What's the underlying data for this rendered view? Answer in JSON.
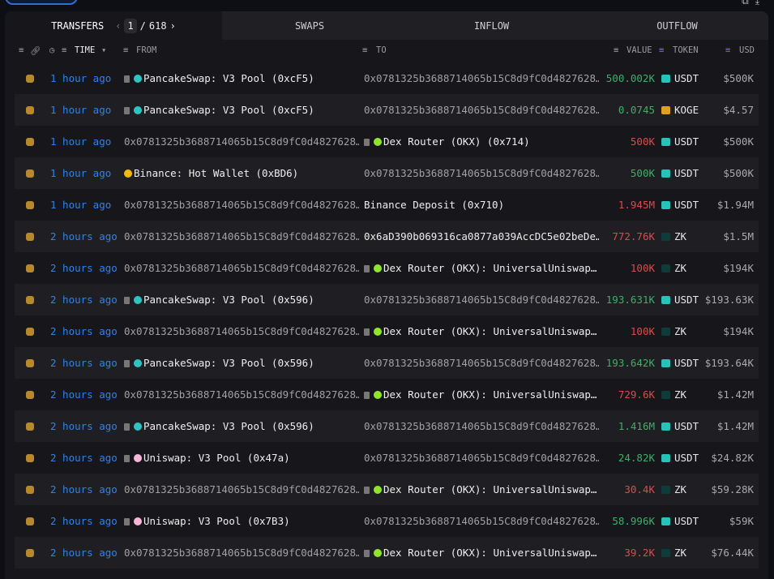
{
  "tabs": {
    "transfers": "TRANSFERS",
    "swaps": "SWAPS",
    "inflow": "INFLOW",
    "outflow": "OUTFLOW"
  },
  "pager": {
    "current": "1",
    "separator": "/",
    "total": "618",
    "prev": "‹",
    "next": "›"
  },
  "columns": {
    "time": "TIME",
    "from": "FROM",
    "to": "TO",
    "value": "VALUE",
    "token": "TOKEN",
    "usd": "USD"
  },
  "colors": {
    "positive": "#3fae6a",
    "negative": "#d94c4c",
    "link": "#2f82e6"
  },
  "rows": [
    {
      "time": "1 hour ago",
      "from": "PancakeSwap: V3 Pool (0xcF5)",
      "from_icon": "pancake",
      "to": "0x0781325b3688714065b15C8d9fC0d4827628…",
      "to_icon": "",
      "value": "500.002K",
      "dir": "pos",
      "token": "USDT",
      "usd": "$500K"
    },
    {
      "time": "1 hour ago",
      "from": "PancakeSwap: V3 Pool (0xcF5)",
      "from_icon": "pancake",
      "to": "0x0781325b3688714065b15C8d9fC0d4827628…",
      "to_icon": "",
      "value": "0.0745",
      "dir": "pos",
      "token": "KOGE",
      "usd": "$4.57"
    },
    {
      "time": "1 hour ago",
      "from": "0x0781325b3688714065b15C8d9fC0d4827628…",
      "from_icon": "",
      "to": "Dex Router (OKX) (0x714)",
      "to_icon": "okx",
      "value": "500K",
      "dir": "neg",
      "token": "USDT",
      "usd": "$500K"
    },
    {
      "time": "1 hour ago",
      "from": "Binance: Hot Wallet (0xBD6)",
      "from_icon": "binance",
      "to": "0x0781325b3688714065b15C8d9fC0d4827628…",
      "to_icon": "",
      "value": "500K",
      "dir": "pos",
      "token": "USDT",
      "usd": "$500K"
    },
    {
      "time": "1 hour ago",
      "from": "0x0781325b3688714065b15C8d9fC0d4827628…",
      "from_icon": "",
      "to": "Binance Deposit (0x710)",
      "to_icon": "none-ent",
      "value": "1.945M",
      "dir": "neg",
      "token": "USDT",
      "usd": "$1.94M"
    },
    {
      "time": "2 hours ago",
      "from": "0x0781325b3688714065b15C8d9fC0d4827628…",
      "from_icon": "",
      "to": "0x6aD390b069316ca0877a039AccDC5e02beDe…",
      "to_icon": "none-ent",
      "value": "772.76K",
      "dir": "neg",
      "token": "ZK",
      "usd": "$1.5M"
    },
    {
      "time": "2 hours ago",
      "from": "0x0781325b3688714065b15C8d9fC0d4827628…",
      "from_icon": "",
      "to": "Dex Router (OKX): UniversalUniswap…",
      "to_icon": "okx",
      "value": "100K",
      "dir": "neg",
      "token": "ZK",
      "usd": "$194K"
    },
    {
      "time": "2 hours ago",
      "from": "PancakeSwap: V3 Pool (0x596)",
      "from_icon": "pancake",
      "to": "0x0781325b3688714065b15C8d9fC0d4827628…",
      "to_icon": "",
      "value": "193.631K",
      "dir": "pos",
      "token": "USDT",
      "usd": "$193.63K"
    },
    {
      "time": "2 hours ago",
      "from": "0x0781325b3688714065b15C8d9fC0d4827628…",
      "from_icon": "",
      "to": "Dex Router (OKX): UniversalUniswap…",
      "to_icon": "okx",
      "value": "100K",
      "dir": "neg",
      "token": "ZK",
      "usd": "$194K"
    },
    {
      "time": "2 hours ago",
      "from": "PancakeSwap: V3 Pool (0x596)",
      "from_icon": "pancake",
      "to": "0x0781325b3688714065b15C8d9fC0d4827628…",
      "to_icon": "",
      "value": "193.642K",
      "dir": "pos",
      "token": "USDT",
      "usd": "$193.64K"
    },
    {
      "time": "2 hours ago",
      "from": "0x0781325b3688714065b15C8d9fC0d4827628…",
      "from_icon": "",
      "to": "Dex Router (OKX): UniversalUniswap…",
      "to_icon": "okx",
      "value": "729.6K",
      "dir": "neg",
      "token": "ZK",
      "usd": "$1.42M"
    },
    {
      "time": "2 hours ago",
      "from": "PancakeSwap: V3 Pool (0x596)",
      "from_icon": "pancake",
      "to": "0x0781325b3688714065b15C8d9fC0d4827628…",
      "to_icon": "",
      "value": "1.416M",
      "dir": "pos",
      "token": "USDT",
      "usd": "$1.42M"
    },
    {
      "time": "2 hours ago",
      "from": "Uniswap: V3 Pool (0x47a)",
      "from_icon": "uniswap",
      "to": "0x0781325b3688714065b15C8d9fC0d4827628…",
      "to_icon": "",
      "value": "24.82K",
      "dir": "pos",
      "token": "USDT",
      "usd": "$24.82K"
    },
    {
      "time": "2 hours ago",
      "from": "0x0781325b3688714065b15C8d9fC0d4827628…",
      "from_icon": "",
      "to": "Dex Router (OKX): UniversalUniswap…",
      "to_icon": "okx",
      "value": "30.4K",
      "dir": "neg",
      "token": "ZK",
      "usd": "$59.28K"
    },
    {
      "time": "2 hours ago",
      "from": "Uniswap: V3 Pool (0x7B3)",
      "from_icon": "uniswap",
      "to": "0x0781325b3688714065b15C8d9fC0d4827628…",
      "to_icon": "",
      "value": "58.996K",
      "dir": "pos",
      "token": "USDT",
      "usd": "$59K"
    },
    {
      "time": "2 hours ago",
      "from": "0x0781325b3688714065b15C8d9fC0d4827628…",
      "from_icon": "",
      "to": "Dex Router (OKX): UniversalUniswap…",
      "to_icon": "okx",
      "value": "39.2K",
      "dir": "neg",
      "token": "ZK",
      "usd": "$76.44K"
    }
  ]
}
